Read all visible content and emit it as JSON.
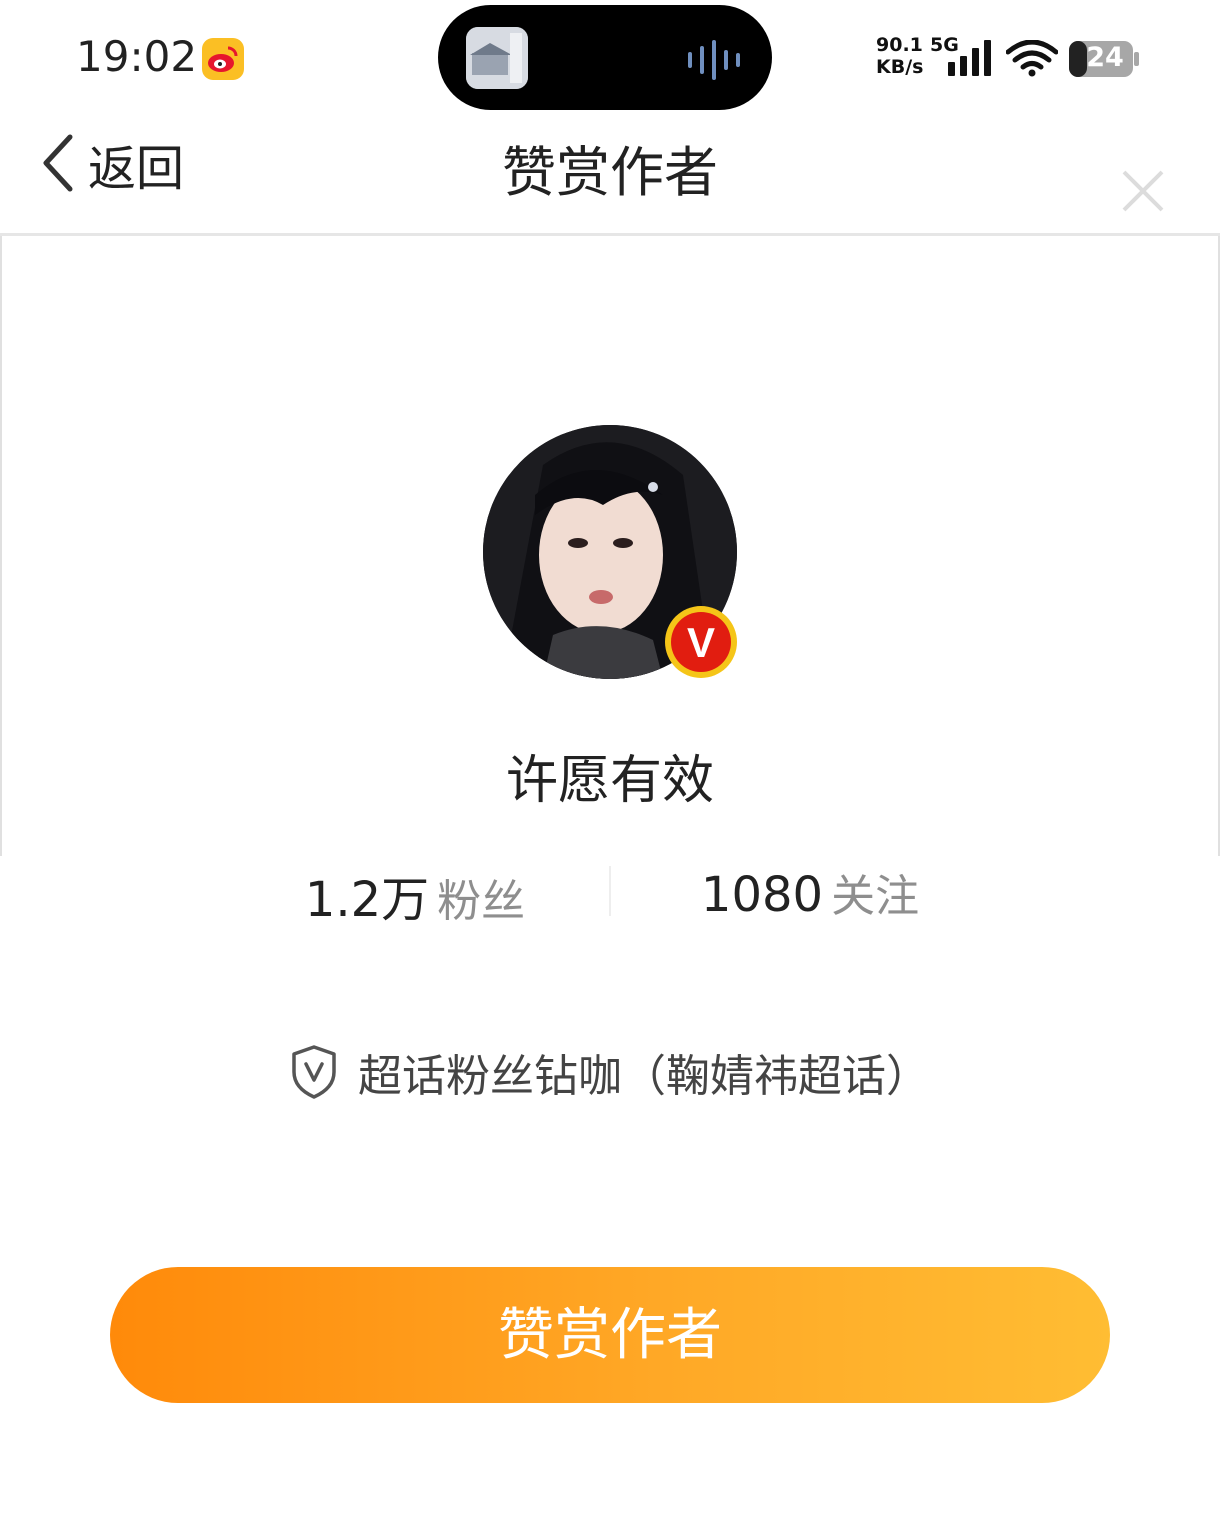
{
  "status_bar": {
    "time": "19:02",
    "network_speed_value": "90.1",
    "network_speed_unit": "KB/s",
    "network_generation": "5G",
    "battery_level": "24"
  },
  "header": {
    "back_label": "返回",
    "title": "赞赏作者"
  },
  "profile": {
    "username": "许愿有效",
    "followers_count": "1.2万",
    "followers_label": "粉丝",
    "following_count": "1080",
    "following_label": "关注",
    "fan_level": "超话粉丝钻咖（鞠婧祎超话）",
    "verified_mark": "V"
  },
  "action": {
    "reward_button_label": "赞赏作者"
  },
  "colors": {
    "button_gradient_start": "#ff8a0a",
    "button_gradient_end": "#ffbd33",
    "verified_badge": "#e11d10"
  }
}
